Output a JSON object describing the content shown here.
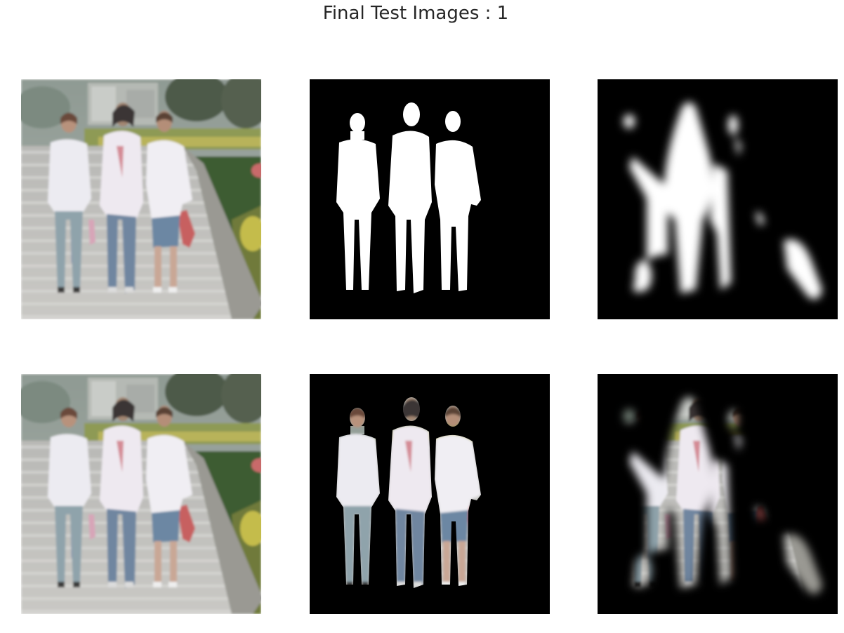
{
  "figure": {
    "title": "Final Test Images : 1"
  },
  "panels": [
    {
      "id": "original-image-top"
    },
    {
      "id": "ground-truth-mask"
    },
    {
      "id": "predicted-mask"
    },
    {
      "id": "original-image-bottom"
    },
    {
      "id": "ground-truth-overlay"
    },
    {
      "id": "predicted-overlay"
    }
  ]
}
